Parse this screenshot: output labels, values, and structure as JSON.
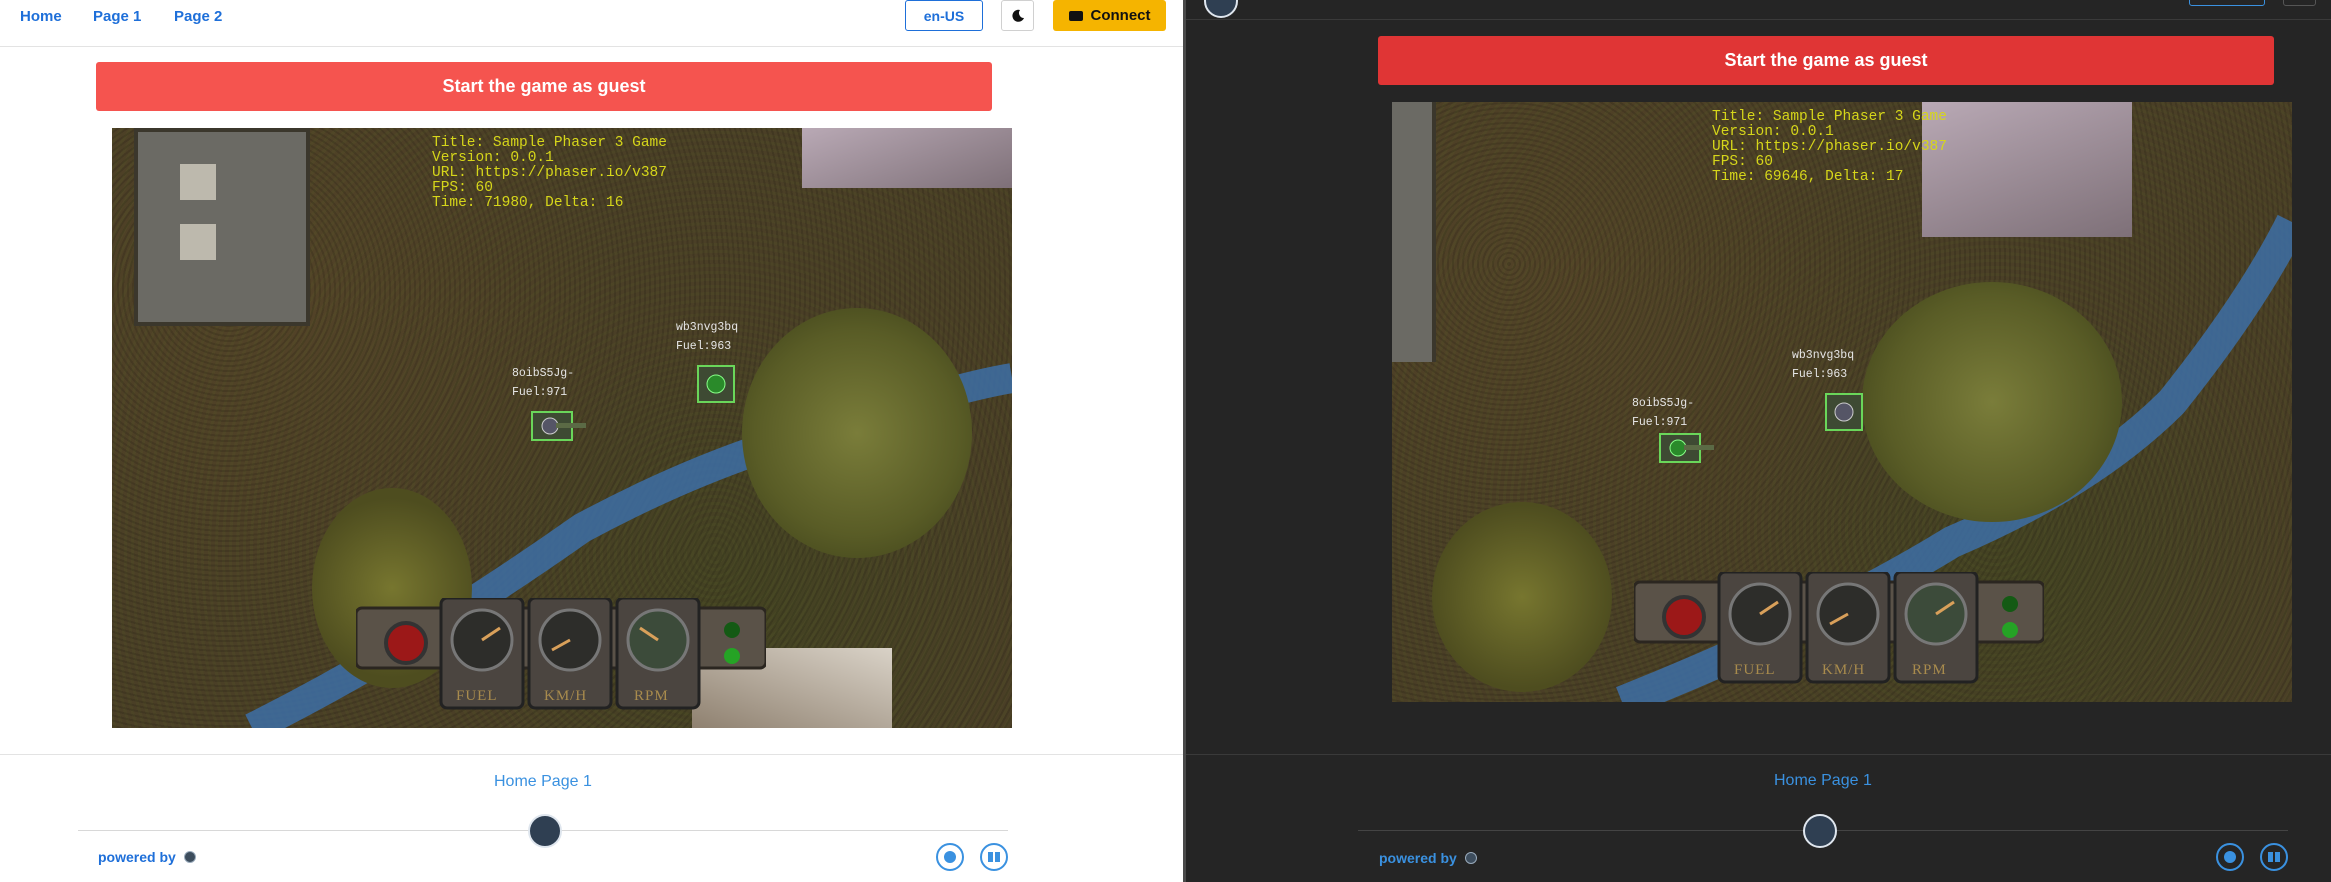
{
  "nav": {
    "links": [
      "Home",
      "Page 1",
      "Page 2"
    ],
    "language": "en-US",
    "connect_label": "Connect"
  },
  "guest_button": "Start the game as guest",
  "colors": {
    "guest_light": "#f5544f",
    "guest_dark": "#e03535",
    "accent": "#1e6fd9",
    "connect": "#f5b400"
  },
  "light_game": {
    "debug": "Title: Sample Phaser 3 Game\nVersion: 0.0.1\nURL: https://phaser.io/v387\nFPS: 60\nTime: 71980, Delta: 16",
    "tank1": "8oibS5Jg-\nFuel:971",
    "tank2": "wb3nvg3bq\nFuel:963"
  },
  "dark_game": {
    "debug": "Title: Sample Phaser 3 Game\nVersion: 0.0.1\nURL: https://phaser.io/v387\nFPS: 60\nTime: 69646, Delta: 17",
    "tank1": "8oibS5Jg-\nFuel:971",
    "tank2": "wb3nvg3bq\nFuel:963"
  },
  "dashboard": {
    "gauges": [
      "FUEL",
      "KM/H",
      "RPM"
    ]
  },
  "footer": {
    "link": "Home Page 1",
    "powered_by": "powered by"
  },
  "icons": [
    "moon-icon",
    "wallet-icon",
    "github-icon",
    "book-icon",
    "logo-icon"
  ]
}
